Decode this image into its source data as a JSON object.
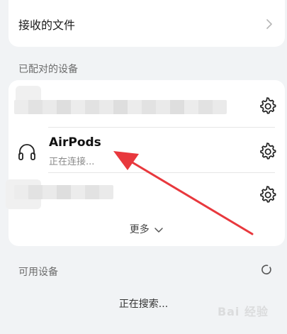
{
  "received_files": {
    "label": "接收的文件"
  },
  "paired_section": {
    "title": "已配对的设备"
  },
  "paired_devices": [
    {
      "name": "",
      "status": "",
      "blurred": true
    },
    {
      "name": "AirPods",
      "status": "正在连接...",
      "icon": "headphone-icon"
    },
    {
      "name": "",
      "status": "",
      "blurred": true
    }
  ],
  "more": {
    "label": "更多"
  },
  "available_section": {
    "title": "可用设备",
    "status": "正在搜索..."
  },
  "watermark": "Bai 经验",
  "colors": {
    "arrow": "#e8383d",
    "background": "#f1f3f5",
    "card": "#ffffff"
  }
}
